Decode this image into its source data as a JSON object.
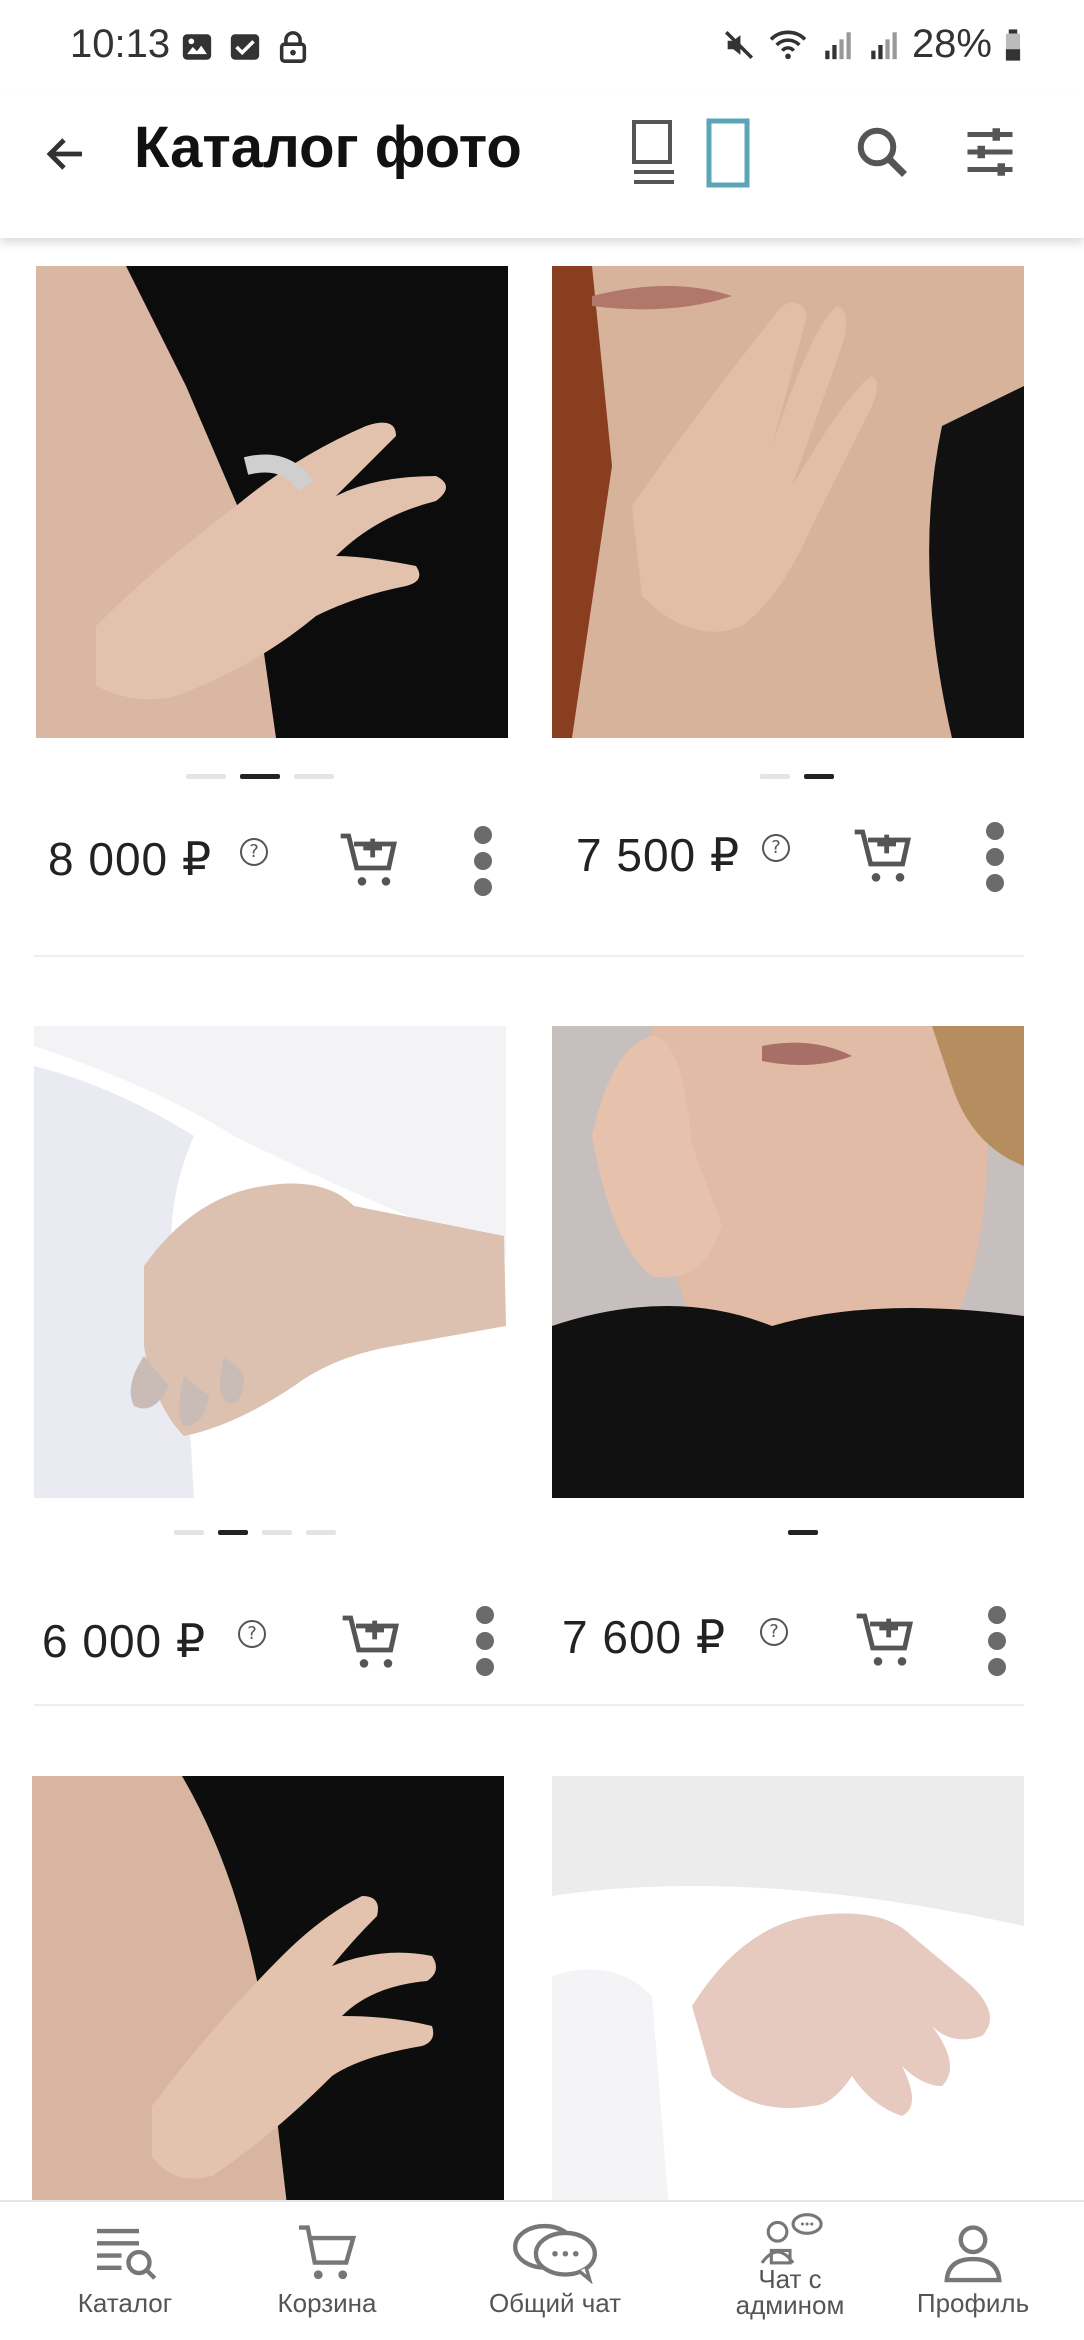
{
  "status_bar": {
    "time": "10:13",
    "battery": "28%"
  },
  "header": {
    "title": "Каталог фото",
    "back_icon": "arrow-left-icon",
    "accent_color": "#5aa5b8"
  },
  "products": [
    {
      "price": "8 000 ₽",
      "image_count": 3,
      "active_image": 2,
      "photo_theme": "black-dress-hand"
    },
    {
      "price": "7 500 ₽",
      "image_count": 2,
      "active_image": 2,
      "photo_theme": "face-black-dress"
    },
    {
      "price": "6 000 ₽",
      "image_count": 4,
      "active_image": 2,
      "photo_theme": "white-shoulder-hand"
    },
    {
      "price": "7 600 ₽",
      "image_count": 1,
      "active_image": 1,
      "photo_theme": "face-hand-lips"
    },
    {
      "price": "",
      "image_count": 0,
      "active_image": 0,
      "photo_theme": "black-dress-hand"
    },
    {
      "price": "",
      "image_count": 0,
      "active_image": 0,
      "photo_theme": "white-shoulder-hand"
    }
  ],
  "bottom_nav": {
    "items": [
      {
        "label": "Каталог",
        "icon": "catalog-search-icon"
      },
      {
        "label": "Корзина",
        "icon": "cart-icon"
      },
      {
        "label": "Общий чат",
        "icon": "chat-bubbles-icon"
      },
      {
        "label": "Чат с\nадмином",
        "icon": "admin-chat-icon"
      },
      {
        "label": "Профиль",
        "icon": "profile-icon"
      }
    ]
  }
}
